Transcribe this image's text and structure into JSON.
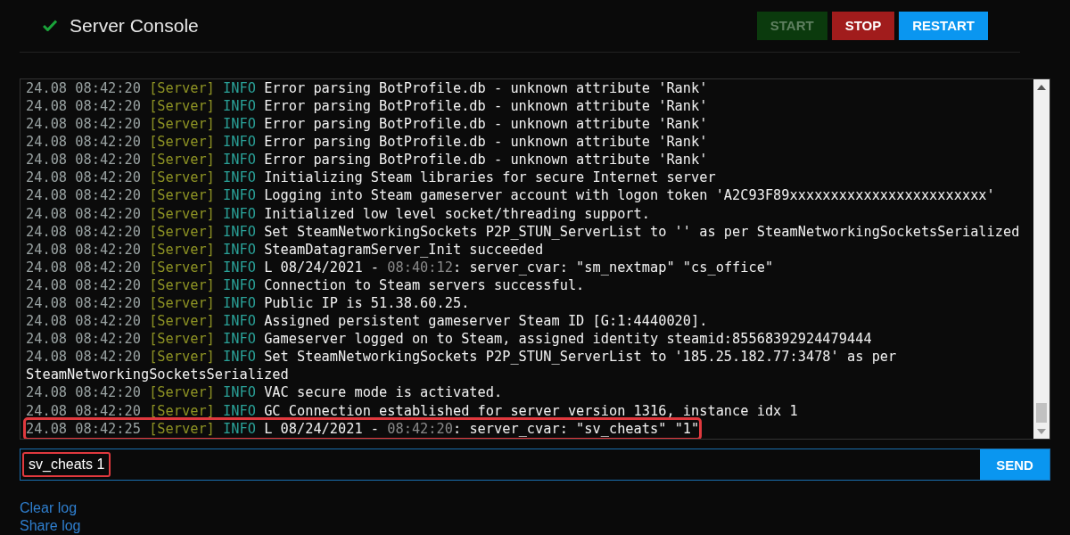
{
  "header": {
    "title": "Server Console",
    "status_ok": true
  },
  "buttons": [
    {
      "label": "START",
      "color": "#0b3a0d",
      "disabled": true
    },
    {
      "label": "STOP",
      "color": "#a11c1c",
      "disabled": false
    },
    {
      "label": "RESTART",
      "color": "#0a96f0",
      "disabled": false
    }
  ],
  "log": [
    {
      "date": "24.08 08:42:20",
      "source": "[Server]",
      "level": "INFO",
      "message": [
        {
          "text": "Error parsing BotProfile.db - unknown attribute 'Rank'",
          "muted": false
        }
      ],
      "highlighted": false
    },
    {
      "date": "24.08 08:42:20",
      "source": "[Server]",
      "level": "INFO",
      "message": [
        {
          "text": "Error parsing BotProfile.db - unknown attribute 'Rank'",
          "muted": false
        }
      ],
      "highlighted": false
    },
    {
      "date": "24.08 08:42:20",
      "source": "[Server]",
      "level": "INFO",
      "message": [
        {
          "text": "Error parsing BotProfile.db - unknown attribute 'Rank'",
          "muted": false
        }
      ],
      "highlighted": false
    },
    {
      "date": "24.08 08:42:20",
      "source": "[Server]",
      "level": "INFO",
      "message": [
        {
          "text": "Error parsing BotProfile.db - unknown attribute 'Rank'",
          "muted": false
        }
      ],
      "highlighted": false
    },
    {
      "date": "24.08 08:42:20",
      "source": "[Server]",
      "level": "INFO",
      "message": [
        {
          "text": "Error parsing BotProfile.db - unknown attribute 'Rank'",
          "muted": false
        }
      ],
      "highlighted": false
    },
    {
      "date": "24.08 08:42:20",
      "source": "[Server]",
      "level": "INFO",
      "message": [
        {
          "text": "Initializing Steam libraries for secure Internet server",
          "muted": false
        }
      ],
      "highlighted": false
    },
    {
      "date": "24.08 08:42:20",
      "source": "[Server]",
      "level": "INFO",
      "message": [
        {
          "text": "Logging into Steam gameserver account with logon token 'A2C93F89xxxxxxxxxxxxxxxxxxxxxxxx'",
          "muted": false
        }
      ],
      "highlighted": false
    },
    {
      "date": "24.08 08:42:20",
      "source": "[Server]",
      "level": "INFO",
      "message": [
        {
          "text": "Initialized low level socket/threading support.",
          "muted": false
        }
      ],
      "highlighted": false
    },
    {
      "date": "24.08 08:42:20",
      "source": "[Server]",
      "level": "INFO",
      "message": [
        {
          "text": "Set SteamNetworkingSockets P2P_STUN_ServerList to '' as per SteamNetworkingSocketsSerialized",
          "muted": false
        }
      ],
      "highlighted": false
    },
    {
      "date": "24.08 08:42:20",
      "source": "[Server]",
      "level": "INFO",
      "message": [
        {
          "text": "SteamDatagramServer_Init succeeded",
          "muted": false
        }
      ],
      "highlighted": false
    },
    {
      "date": "24.08 08:42:20",
      "source": "[Server]",
      "level": "INFO",
      "message": [
        {
          "text": "L 08/24/2021 - ",
          "muted": false
        },
        {
          "text": "08:40:12",
          "muted": true
        },
        {
          "text": ": server_cvar: \"sm_nextmap\" \"cs_office\"",
          "muted": false
        }
      ],
      "highlighted": false
    },
    {
      "date": "24.08 08:42:20",
      "source": "[Server]",
      "level": "INFO",
      "message": [
        {
          "text": "Connection to Steam servers successful.",
          "muted": false
        }
      ],
      "highlighted": false
    },
    {
      "date": "24.08 08:42:20",
      "source": "[Server]",
      "level": "INFO",
      "message": [
        {
          "text": "Public IP is 51.38.60.25.",
          "muted": false
        }
      ],
      "highlighted": false
    },
    {
      "date": "24.08 08:42:20",
      "source": "[Server]",
      "level": "INFO",
      "message": [
        {
          "text": "Assigned persistent gameserver Steam ID [G:1:4440020].",
          "muted": false
        }
      ],
      "highlighted": false
    },
    {
      "date": "24.08 08:42:20",
      "source": "[Server]",
      "level": "INFO",
      "message": [
        {
          "text": "Gameserver logged on to Steam, assigned identity steamid:85568392924479444",
          "muted": false
        }
      ],
      "highlighted": false
    },
    {
      "date": "24.08 08:42:20",
      "source": "[Server]",
      "level": "INFO",
      "message": [
        {
          "text": "Set SteamNetworkingSockets P2P_STUN_ServerList to '185.25.182.77:3478' as per SteamNetworkingSocketsSerialized",
          "muted": false
        }
      ],
      "highlighted": false
    },
    {
      "date": "24.08 08:42:20",
      "source": "[Server]",
      "level": "INFO",
      "message": [
        {
          "text": "VAC secure mode is activated.",
          "muted": false
        }
      ],
      "highlighted": false
    },
    {
      "date": "24.08 08:42:20",
      "source": "[Server]",
      "level": "INFO",
      "message": [
        {
          "text": "GC Connection established for server version 1316, instance idx 1",
          "muted": false
        }
      ],
      "highlighted": false
    },
    {
      "date": "24.08 08:42:25",
      "source": "[Server]",
      "level": "INFO",
      "message": [
        {
          "text": "L 08/24/2021 - ",
          "muted": false
        },
        {
          "text": "08:42:20",
          "muted": true
        },
        {
          "text": ": server_cvar: \"sv_cheats\" \"1\"",
          "muted": false
        }
      ],
      "highlighted": true
    }
  ],
  "command": {
    "value": "sv_cheats 1",
    "highlighted": true,
    "send_label": "SEND"
  },
  "links": [
    "Clear log",
    "Share log"
  ]
}
